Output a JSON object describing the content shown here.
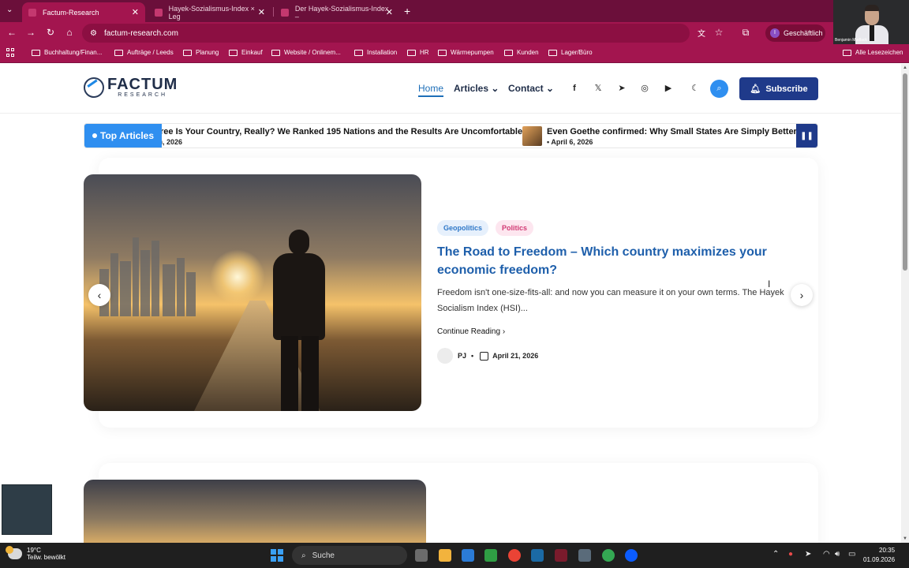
{
  "browser": {
    "tabs": [
      {
        "title": "Factum-Research"
      },
      {
        "title": "Hayek-Sozialismus-Index × Leg"
      },
      {
        "title": "Der Hayek-Sozialismus-Index –"
      }
    ],
    "url": "factum-research.com",
    "profile_label": "Geschäftlich",
    "profile_initial": "I",
    "bookmarks": [
      "Buchhaltung/Finan...",
      "Aufträge / Leeds",
      "Planung",
      "Einkauf",
      "Website / Onlinem...",
      "Installation",
      "HR",
      "Wärmepumpen",
      "Kunden",
      "Lager/Büro"
    ],
    "all_bookmarks": "Alle Lesezeichen",
    "webcam_name": "Benjamin Mudlack",
    "accent_color": "#a3154f"
  },
  "site": {
    "logo_main": "FACTUM",
    "logo_sub": "RESEARCH",
    "nav": {
      "home": "Home",
      "articles": "Articles",
      "contact": "Contact"
    },
    "subscribe": "Subscribe",
    "ticker": {
      "label": "Top Articles",
      "items": [
        {
          "title": "ree Is Your Country, Really? We Ranked 195 Nations and the Results Are Uncomfortable",
          "date": "), 2026"
        },
        {
          "title": "Even Goethe confirmed: Why Small States Are Simply Better",
          "date": "April 6, 2026"
        }
      ]
    },
    "featured": {
      "tags": [
        "Geopolitics",
        "Politics"
      ],
      "title": "The Road to Freedom – Which country maximizes your economic freedom?",
      "excerpt": "Freedom isn't one-size-fits-all: and now you can measure it on your own terms. The Hayek Socialism Index (HSI)...",
      "continue": "Continue Reading",
      "author": "PJ",
      "date": "April 21, 2026"
    },
    "brand_color": "#1f3a8a",
    "link_color": "#1e5fab"
  },
  "taskbar": {
    "temp": "19°C",
    "weather": "Teilw. bewölkt",
    "search": "Suche",
    "time": "20:35",
    "date": "01.09.2026"
  }
}
